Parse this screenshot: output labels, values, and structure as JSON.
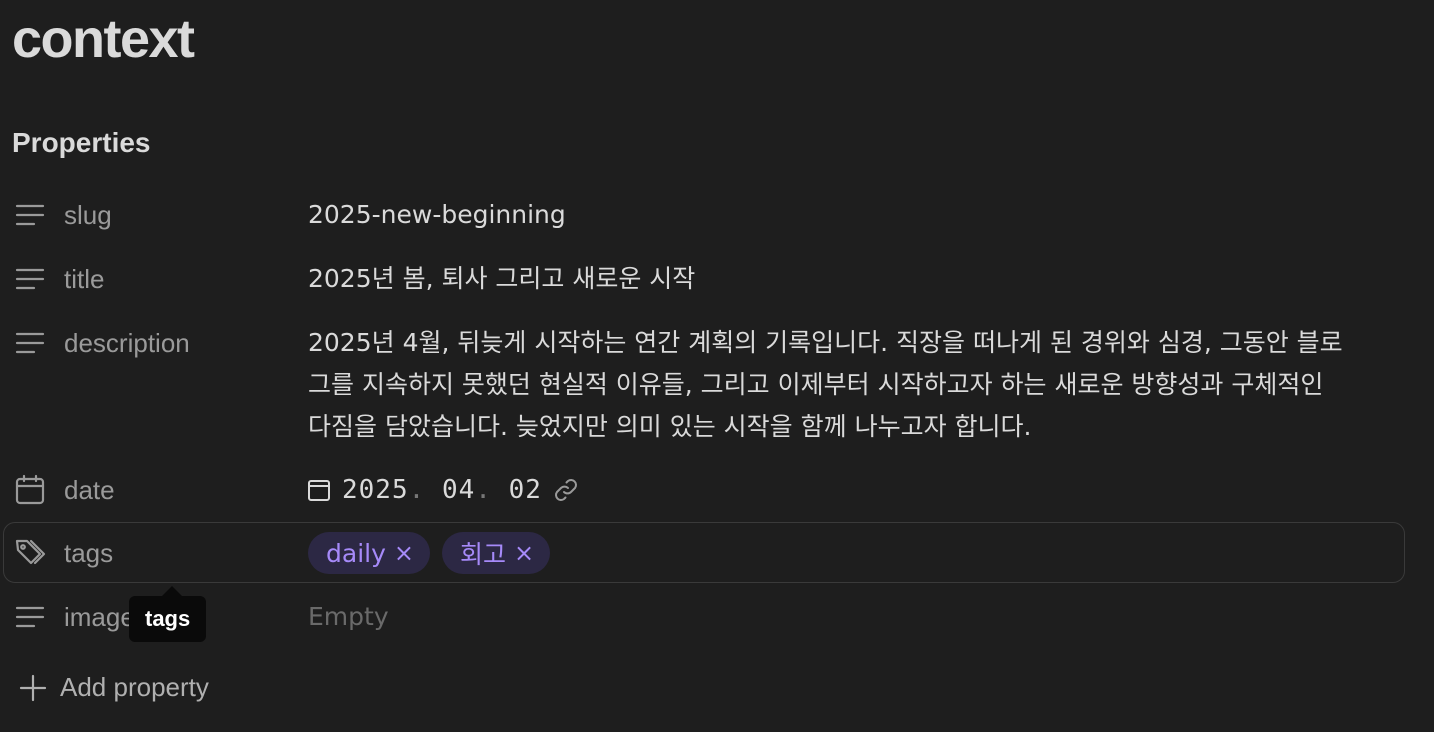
{
  "document": {
    "title": "context"
  },
  "properties": {
    "heading": "Properties",
    "slug": {
      "key": "slug",
      "icon": "text-lines-icon",
      "value": "2025-new-beginning"
    },
    "title": {
      "key": "title",
      "icon": "text-lines-icon",
      "value": "2025년 봄, 퇴사 그리고 새로운 시작"
    },
    "description": {
      "key": "description",
      "icon": "text-lines-icon",
      "lines": [
        "2025년 4월, 뒤늦게 시작하는 연간 계획의 기록입니다. 직장을 떠나게 된 경위와 심경, 그동안 블로",
        "그를 지속하지 못했던 현실적 이유들, 그리고 이제부터 시작하고자 하는 새로운 방향성과 구체적인",
        "다짐을 담았습니다. 늦었지만 의미 있는 시작을 함께 나누고자 합니다."
      ]
    },
    "date": {
      "key": "date",
      "icon": "calendar-icon",
      "year": "2025",
      "month": "04",
      "day": "02",
      "separator": "."
    },
    "tags": {
      "key": "tags",
      "icon": "tags-icon",
      "items": [
        {
          "label": "daily",
          "remove": "×"
        },
        {
          "label": "회고",
          "remove": "×"
        }
      ]
    },
    "image": {
      "key": "image",
      "icon": "text-lines-icon",
      "placeholder": "Empty"
    }
  },
  "tooltip": {
    "text": "tags"
  },
  "add_property": {
    "label": "Add property",
    "icon": "plus-icon"
  },
  "colors": {
    "background": "#1e1e1e",
    "text": "#dadada",
    "muted": "#9a9a9a",
    "tag_bg": "#2c2844",
    "tag_text": "#a68af9"
  }
}
